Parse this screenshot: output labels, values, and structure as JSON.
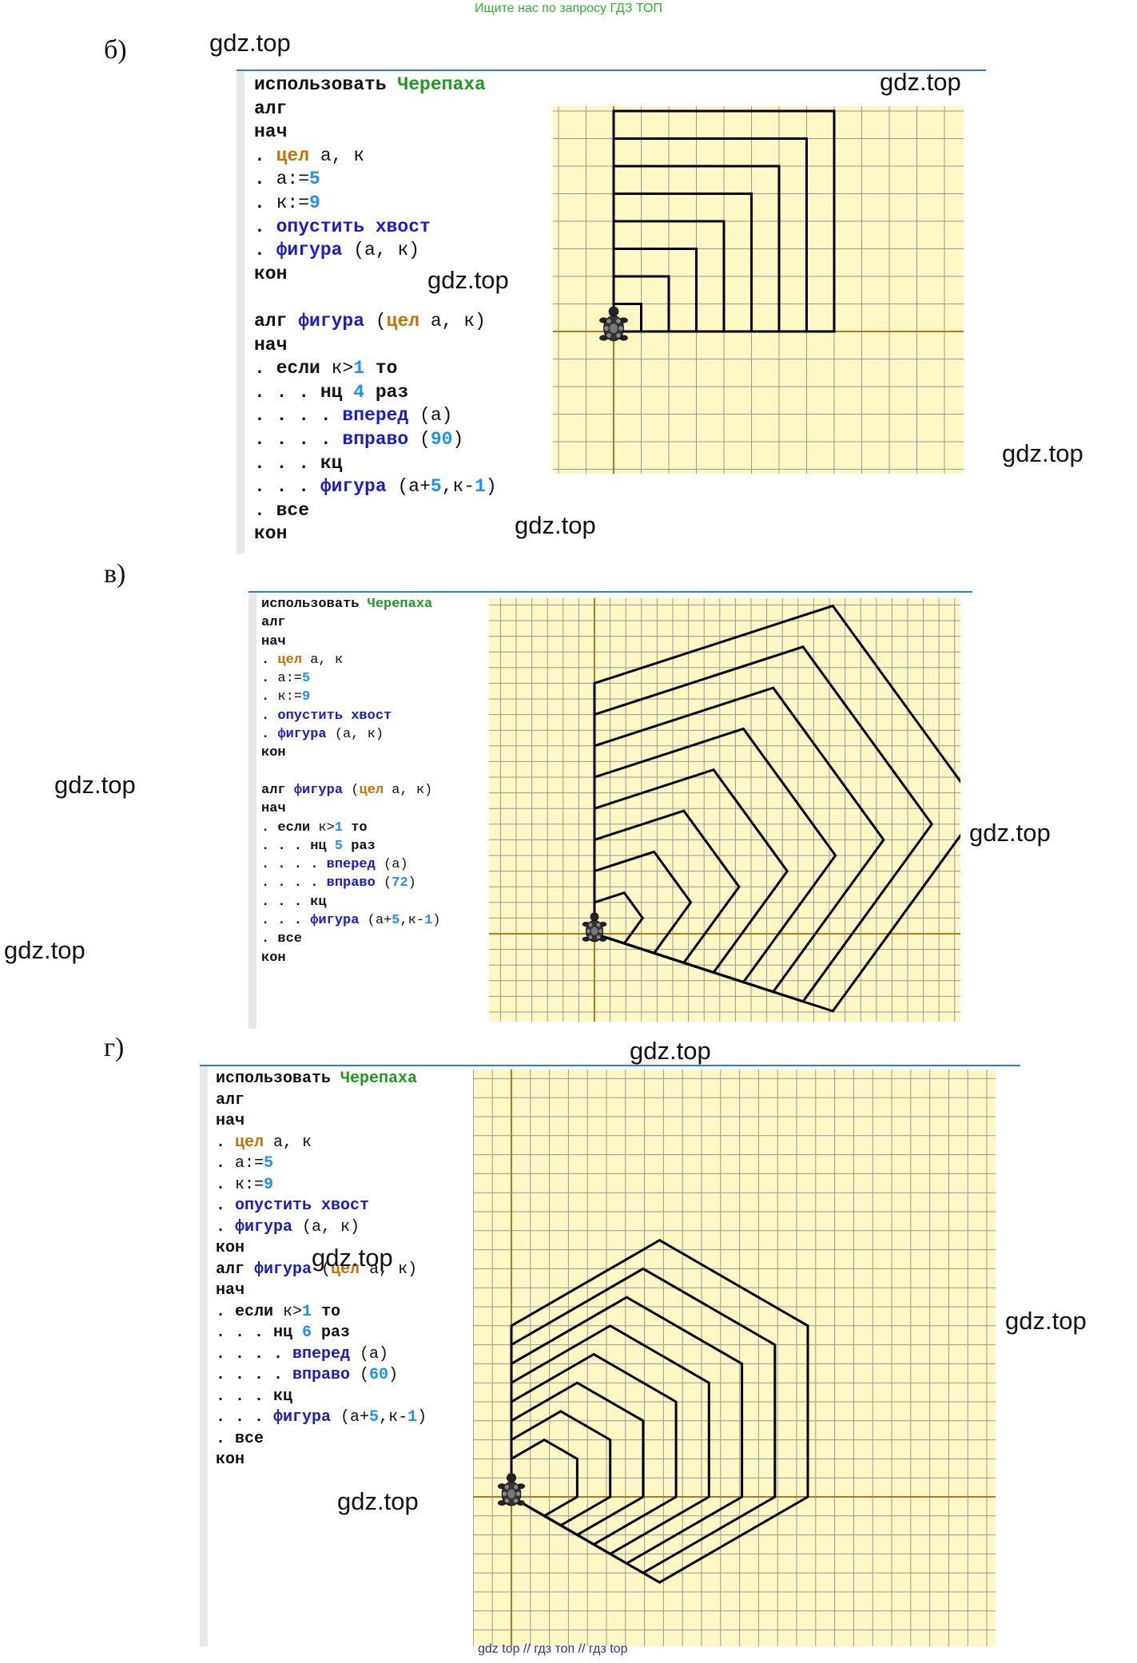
{
  "header_note": "Ищите нас по запросу ГДЗ ТОП",
  "footer_note": "gdz top  //  гдз топ  //  гдз top",
  "watermark": "gdz.top",
  "sections": [
    {
      "letter": "б)",
      "code": [
        [
          [
            "kw",
            "использовать "
          ],
          [
            "kw-green",
            "Черепаха"
          ]
        ],
        [
          [
            "kw",
            "алг"
          ]
        ],
        [
          [
            "kw",
            "нач"
          ]
        ],
        [
          [
            "dot",
            ". "
          ],
          [
            "kw-type",
            "цел"
          ],
          [
            "plain",
            " а, к"
          ]
        ],
        [
          [
            "dot",
            ". "
          ],
          [
            "plain",
            "а:="
          ],
          [
            "num",
            "5"
          ]
        ],
        [
          [
            "dot",
            ". "
          ],
          [
            "plain",
            "к:="
          ],
          [
            "num",
            "9"
          ]
        ],
        [
          [
            "dot",
            ". "
          ],
          [
            "kw-blue",
            "опустить хвост"
          ]
        ],
        [
          [
            "dot",
            ". "
          ],
          [
            "kw-blue",
            "фигура"
          ],
          [
            "plain",
            " (а, к)"
          ]
        ],
        [
          [
            "kw",
            "кон"
          ]
        ],
        [
          [
            "plain",
            ""
          ]
        ],
        [
          [
            "kw",
            "алг "
          ],
          [
            "kw-blue",
            "фигура"
          ],
          [
            "plain",
            " ("
          ],
          [
            "kw-type",
            "цел"
          ],
          [
            "plain",
            " а, к)"
          ]
        ],
        [
          [
            "kw",
            "нач"
          ]
        ],
        [
          [
            "dot",
            ". "
          ],
          [
            "kw",
            "если"
          ],
          [
            "plain",
            " к>"
          ],
          [
            "num",
            "1"
          ],
          [
            "kw",
            " то"
          ]
        ],
        [
          [
            "dot",
            ". . . "
          ],
          [
            "kw",
            "нц "
          ],
          [
            "num",
            "4"
          ],
          [
            "kw",
            " раз"
          ]
        ],
        [
          [
            "dot",
            ". . . . "
          ],
          [
            "kw-blue",
            "вперед"
          ],
          [
            "plain",
            " (а)"
          ]
        ],
        [
          [
            "dot",
            ". . . . "
          ],
          [
            "kw-blue",
            "вправо"
          ],
          [
            "plain",
            " ("
          ],
          [
            "num",
            "90"
          ],
          [
            "plain",
            ")"
          ]
        ],
        [
          [
            "dot",
            ". . . "
          ],
          [
            "kw",
            "кц"
          ]
        ],
        [
          [
            "dot",
            ". . . "
          ],
          [
            "kw-blue",
            "фигура"
          ],
          [
            "plain",
            " (а+"
          ],
          [
            "num",
            "5"
          ],
          [
            "plain",
            ",к-"
          ],
          [
            "num",
            "1"
          ],
          [
            "plain",
            ")"
          ]
        ],
        [
          [
            "dot",
            ". "
          ],
          [
            "kw",
            "все"
          ]
        ],
        [
          [
            "kw",
            "кон"
          ]
        ]
      ]
    },
    {
      "letter": "в)",
      "code": [
        [
          [
            "kw",
            "использовать "
          ],
          [
            "kw-green",
            "Черепаха"
          ]
        ],
        [
          [
            "kw",
            "алг"
          ]
        ],
        [
          [
            "kw",
            "нач"
          ]
        ],
        [
          [
            "dot",
            ". "
          ],
          [
            "kw-type",
            "цел"
          ],
          [
            "plain",
            " а, к"
          ]
        ],
        [
          [
            "dot",
            ". "
          ],
          [
            "plain",
            "а:="
          ],
          [
            "num",
            "5"
          ]
        ],
        [
          [
            "dot",
            ". "
          ],
          [
            "plain",
            "к:="
          ],
          [
            "num",
            "9"
          ]
        ],
        [
          [
            "dot",
            ". "
          ],
          [
            "kw-blue",
            "опустить хвост"
          ]
        ],
        [
          [
            "dot",
            ". "
          ],
          [
            "kw-blue",
            "фигура"
          ],
          [
            "plain",
            " (а, к)"
          ]
        ],
        [
          [
            "kw",
            "кон"
          ]
        ],
        [
          [
            "plain",
            ""
          ]
        ],
        [
          [
            "kw",
            "алг "
          ],
          [
            "kw-blue",
            "фигура"
          ],
          [
            "plain",
            " ("
          ],
          [
            "kw-type",
            "цел"
          ],
          [
            "plain",
            " а, к)"
          ]
        ],
        [
          [
            "kw",
            "нач"
          ]
        ],
        [
          [
            "dot",
            ". "
          ],
          [
            "kw",
            "если"
          ],
          [
            "plain",
            " к>"
          ],
          [
            "num",
            "1"
          ],
          [
            "kw",
            " то"
          ]
        ],
        [
          [
            "dot",
            ". . . "
          ],
          [
            "kw",
            "нц "
          ],
          [
            "num",
            "5"
          ],
          [
            "kw",
            " раз"
          ]
        ],
        [
          [
            "dot",
            ". . . . "
          ],
          [
            "kw-blue",
            "вперед"
          ],
          [
            "plain",
            " (а)"
          ]
        ],
        [
          [
            "dot",
            ". . . . "
          ],
          [
            "kw-blue",
            "вправо"
          ],
          [
            "plain",
            " ("
          ],
          [
            "num",
            "72"
          ],
          [
            "plain",
            ")"
          ]
        ],
        [
          [
            "dot",
            ". . . "
          ],
          [
            "kw",
            "кц"
          ]
        ],
        [
          [
            "dot",
            ". . . "
          ],
          [
            "kw-blue",
            "фигура"
          ],
          [
            "plain",
            " (а+"
          ],
          [
            "num",
            "5"
          ],
          [
            "plain",
            ",к-"
          ],
          [
            "num",
            "1"
          ],
          [
            "plain",
            ")"
          ]
        ],
        [
          [
            "dot",
            ". "
          ],
          [
            "kw",
            "все"
          ]
        ],
        [
          [
            "kw",
            "кон"
          ]
        ]
      ]
    },
    {
      "letter": "г)",
      "code": [
        [
          [
            "kw",
            "использовать "
          ],
          [
            "kw-green",
            "Черепаха"
          ]
        ],
        [
          [
            "kw",
            "алг"
          ]
        ],
        [
          [
            "kw",
            "нач"
          ]
        ],
        [
          [
            "dot",
            ". "
          ],
          [
            "kw-type",
            "цел"
          ],
          [
            "plain",
            " а, к"
          ]
        ],
        [
          [
            "dot",
            ". "
          ],
          [
            "plain",
            "а:="
          ],
          [
            "num",
            "5"
          ]
        ],
        [
          [
            "dot",
            ". "
          ],
          [
            "plain",
            "к:="
          ],
          [
            "num",
            "9"
          ]
        ],
        [
          [
            "dot",
            ". "
          ],
          [
            "kw-blue",
            "опустить хвост"
          ]
        ],
        [
          [
            "dot",
            ". "
          ],
          [
            "kw-blue",
            "фигура"
          ],
          [
            "plain",
            " (а, к)"
          ]
        ],
        [
          [
            "kw",
            "кон"
          ]
        ],
        [
          [
            "kw",
            "алг "
          ],
          [
            "kw-blue",
            "фигура"
          ],
          [
            "plain",
            " ("
          ],
          [
            "kw-type",
            "цел"
          ],
          [
            "plain",
            " а, к)"
          ]
        ],
        [
          [
            "kw",
            "нач"
          ]
        ],
        [
          [
            "dot",
            ". "
          ],
          [
            "kw",
            "если"
          ],
          [
            "plain",
            " к>"
          ],
          [
            "num",
            "1"
          ],
          [
            "kw",
            " то"
          ]
        ],
        [
          [
            "dot",
            ". . . "
          ],
          [
            "kw",
            "нц "
          ],
          [
            "num",
            "6"
          ],
          [
            "kw",
            " раз"
          ]
        ],
        [
          [
            "dot",
            ". . . . "
          ],
          [
            "kw-blue",
            "вперед"
          ],
          [
            "plain",
            " (а)"
          ]
        ],
        [
          [
            "dot",
            ". . . . "
          ],
          [
            "kw-blue",
            "вправо"
          ],
          [
            "plain",
            " ("
          ],
          [
            "num",
            "60"
          ],
          [
            "plain",
            ")"
          ]
        ],
        [
          [
            "dot",
            ". . . "
          ],
          [
            "kw",
            "кц"
          ]
        ],
        [
          [
            "dot",
            ". . . "
          ],
          [
            "kw-blue",
            "фигура"
          ],
          [
            "plain",
            " (а+"
          ],
          [
            "num",
            "5"
          ],
          [
            "plain",
            ",к-"
          ],
          [
            "num",
            "1"
          ],
          [
            "plain",
            ")"
          ]
        ],
        [
          [
            "dot",
            ". "
          ],
          [
            "kw",
            "все"
          ]
        ],
        [
          [
            "kw",
            "кон"
          ]
        ]
      ]
    }
  ],
  "colors": {
    "grid_bg": "#fdf8c4",
    "grid_line": "#9a9a9a",
    "axis": "#b07a22",
    "figure_line": "#000000",
    "rule": "#2f7fc8"
  }
}
